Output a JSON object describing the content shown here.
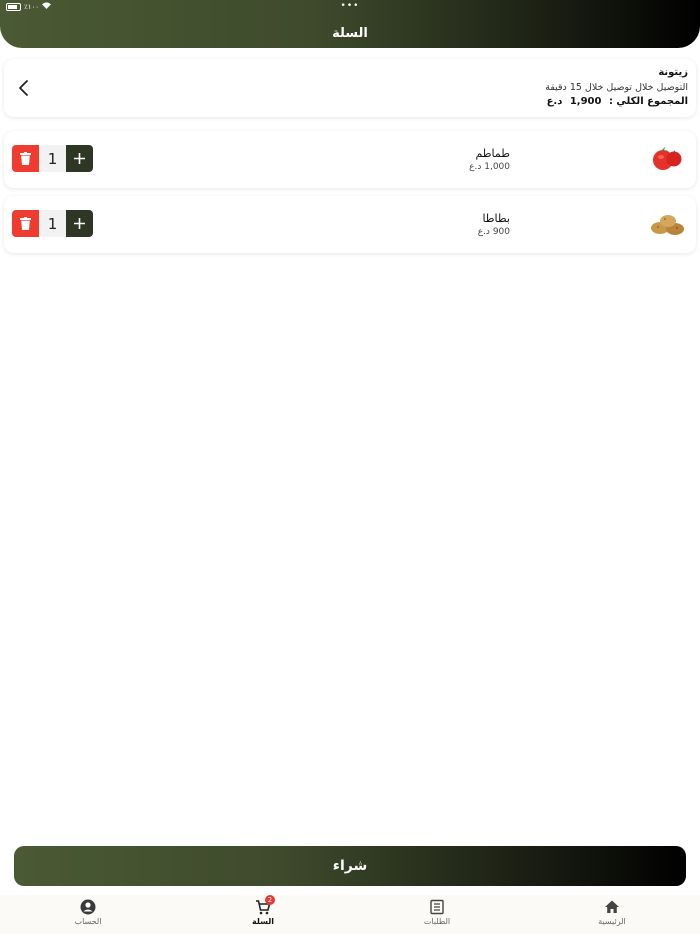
{
  "status_bar": {
    "carrier_text": "٪۱۰۰"
  },
  "header": {
    "title": "السلة"
  },
  "store": {
    "name": "زيتونة",
    "delivery": "التوصيل خلال توصيل خلال 15 دقيقة",
    "total_label": "المجموع الكلي :",
    "total_value": "1,900",
    "currency": "د.ع"
  },
  "cart_items": [
    {
      "name": "طماطم",
      "price": "1,000 د.ع",
      "quantity": "1",
      "image_icon": "tomato-icon"
    },
    {
      "name": "بطاطا",
      "price": "900 د.ع",
      "quantity": "1",
      "image_icon": "potato-icon"
    }
  ],
  "buy_button": {
    "label": "شراء"
  },
  "tabbar": {
    "account": "الحساب",
    "cart": "السلة",
    "cart_badge": "2",
    "orders": "الطلبات",
    "home": "الرئيسية"
  },
  "colors": {
    "brand_dark": "#2e3724",
    "brand_olive": "#4a5a34",
    "delete_red": "#f03b31"
  }
}
